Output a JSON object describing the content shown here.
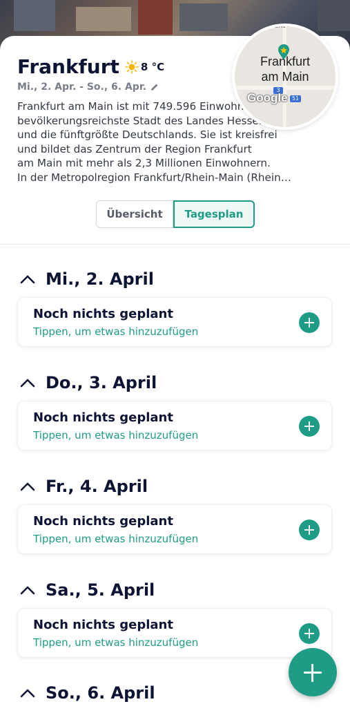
{
  "trip": {
    "city": "Frankfurt",
    "temperature": "8 °C",
    "weather_icon": "sun-icon",
    "date_range": "Mi., 2. Apr. - So., 6. Apr."
  },
  "map": {
    "label": "Frankfurt am Main",
    "label_line1": "Frankfurt",
    "label_line2": "am Main",
    "top_text": "Car Rent",
    "logo": "Google",
    "shield1": "3",
    "shield2": "51"
  },
  "description": {
    "lines": [
      "Frankfurt am Main ist mit 749.596 Einwohnern die",
      "bevölkerungsreichste Stadt des Landes Hessen",
      "und die fünftgrößte Deutschlands. Sie ist kreisfrei",
      "und bildet das Zentrum der Region Frankfurt",
      "am Main mit mehr als 2,3 Millionen Einwohnern.",
      "In der Metropolregion Frankfurt/Rhein-Main (Rhein…"
    ]
  },
  "tabs": [
    {
      "label": "Übersicht",
      "active": false
    },
    {
      "label": "Tagesplan",
      "active": true
    }
  ],
  "days": [
    {
      "title": "Mi., 2. April",
      "card_title": "Noch nichts geplant",
      "card_sub": "Tippen, um etwas hinzuzufügen"
    },
    {
      "title": "Do., 3. April",
      "card_title": "Noch nichts geplant",
      "card_sub": "Tippen, um etwas hinzuzufügen"
    },
    {
      "title": "Fr., 4. April",
      "card_title": "Noch nichts geplant",
      "card_sub": "Tippen, um etwas hinzuzufügen"
    },
    {
      "title": "Sa., 5. April",
      "card_title": "Noch nichts geplant",
      "card_sub": "Tippen, um etwas hinzuzufügen"
    },
    {
      "title": "So., 6. April"
    }
  ],
  "colors": {
    "accent": "#1f9c86",
    "title": "#0d1433"
  }
}
